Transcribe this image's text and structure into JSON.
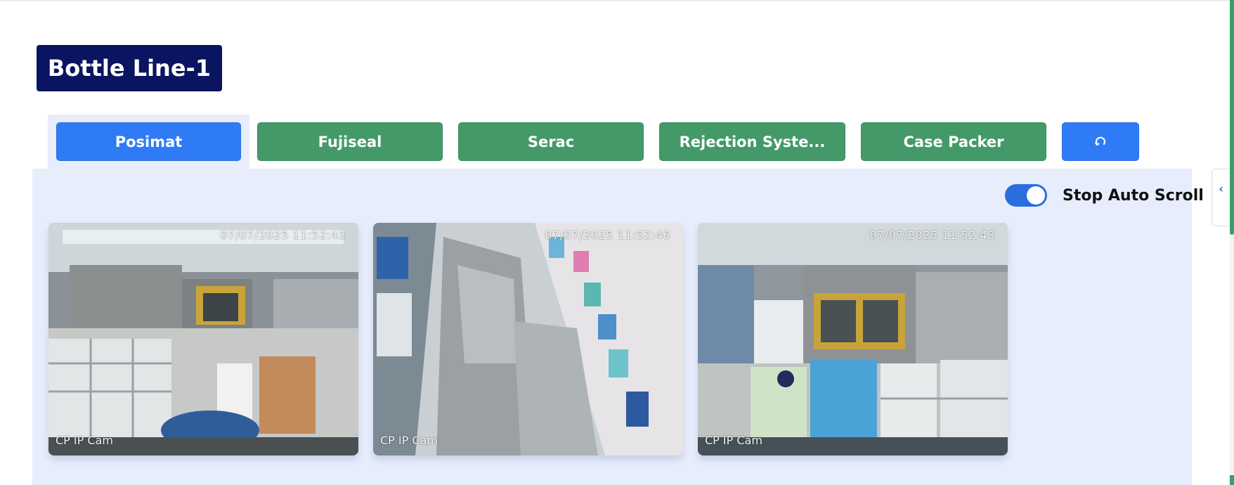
{
  "header": {
    "line_title": "Bottle Line-1"
  },
  "tabs": [
    {
      "label": "Posimat",
      "color": "#2f7bf6",
      "active": true
    },
    {
      "label": "Fujiseal",
      "color": "#439a68",
      "active": false
    },
    {
      "label": "Serac",
      "color": "#439a68",
      "active": false
    },
    {
      "label": "Rejection Syste...",
      "color": "#439a68",
      "active": false
    },
    {
      "label": "Case Packer",
      "color": "#439a68",
      "active": false
    }
  ],
  "refresh_icon": "refresh-icon",
  "toggle": {
    "label": "Stop Auto Scroll",
    "on": true,
    "color": "#2a6ee0"
  },
  "cameras": [
    {
      "timestamp": "07/07/2025 11:52:43",
      "name": "CP IP Cam"
    },
    {
      "timestamp": "07/07/2025 11:52:46",
      "name": "CP IP Cam"
    },
    {
      "timestamp": "07/07/2025 11:52:43",
      "name": "CP IP Cam"
    }
  ],
  "side_panel_icon": "chevron-left-icon",
  "colors": {
    "title_bg": "#0b1460",
    "panel_bg": "#e7edfb",
    "accent_blue": "#2f7bf6",
    "accent_green": "#439a68"
  }
}
